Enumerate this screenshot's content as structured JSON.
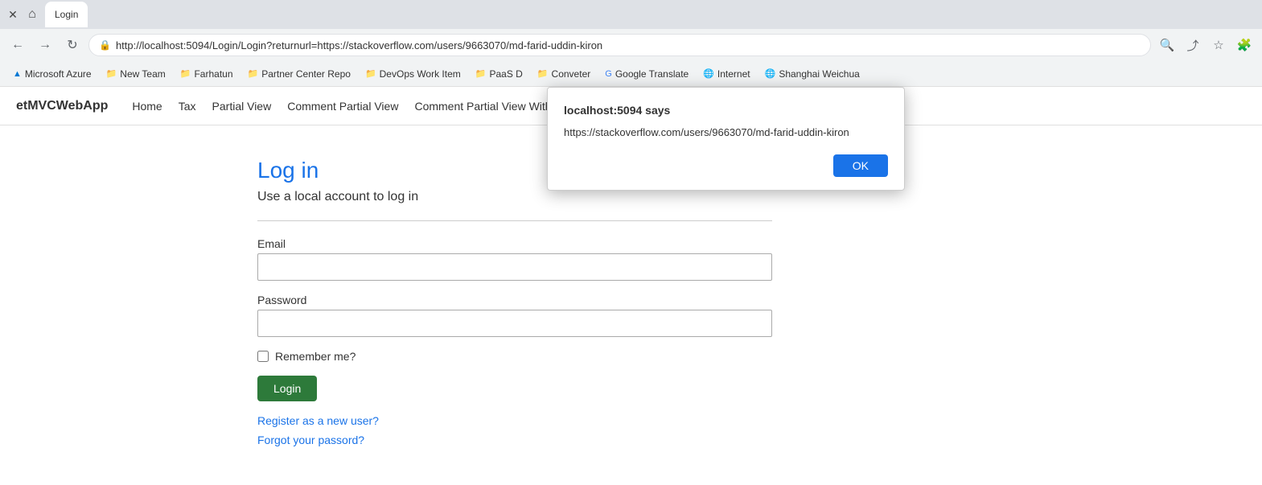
{
  "browser": {
    "url": "http://localhost:5094/Login/Login?returnurl=https://stackoverflow.com/users/9663070/md-farid-uddin-kiron",
    "tab_title": "Login"
  },
  "bookmarks": [
    {
      "label": "Microsoft Azure",
      "icon": "azure"
    },
    {
      "label": "New Team",
      "icon": "folder"
    },
    {
      "label": "Farhatun",
      "icon": "folder"
    },
    {
      "label": "Partner Center Repo",
      "icon": "folder"
    },
    {
      "label": "DevOps Work Item",
      "icon": "folder"
    },
    {
      "label": "PaaS D",
      "icon": "folder"
    },
    {
      "label": "Conveter",
      "icon": "folder"
    },
    {
      "label": "Google Translate",
      "icon": "google"
    },
    {
      "label": "Internet",
      "icon": "globe"
    },
    {
      "label": "Shanghai Weichua",
      "icon": "globe"
    }
  ],
  "nav": {
    "site_title": "etMVCWebApp",
    "links": [
      "Home",
      "Tax",
      "Partial View",
      "Comment Partial View",
      "Comment Partial View With DB"
    ]
  },
  "login": {
    "title": "Log in",
    "subtitle": "Use a local account to log in",
    "email_label": "Email",
    "email_placeholder": "",
    "password_label": "Password",
    "password_placeholder": "",
    "remember_label": "Remember me?",
    "login_button": "Login",
    "register_link": "Register as a new user?",
    "forgot_link": "Forgot your passord?"
  },
  "alert": {
    "title": "localhost:5094 says",
    "message": "https://stackoverflow.com/users/9663070/md-farid-uddin-kiron",
    "ok_label": "OK"
  }
}
